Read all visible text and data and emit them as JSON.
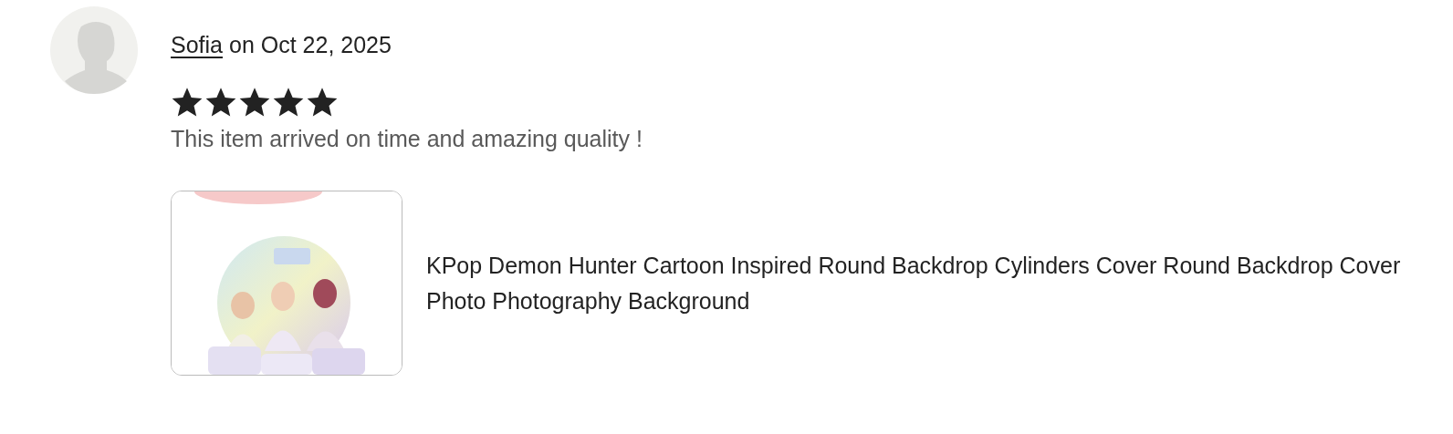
{
  "review": {
    "author": "Sofia",
    "date_text": "on Oct 22, 2025",
    "stars": 5,
    "text": "This item arrived on time and amazing quality !"
  },
  "item": {
    "title": "KPop Demon Hunter Cartoon Inspired Round Backdrop Cylinders Cover Round Backdrop Cover Photo Photography Background"
  }
}
